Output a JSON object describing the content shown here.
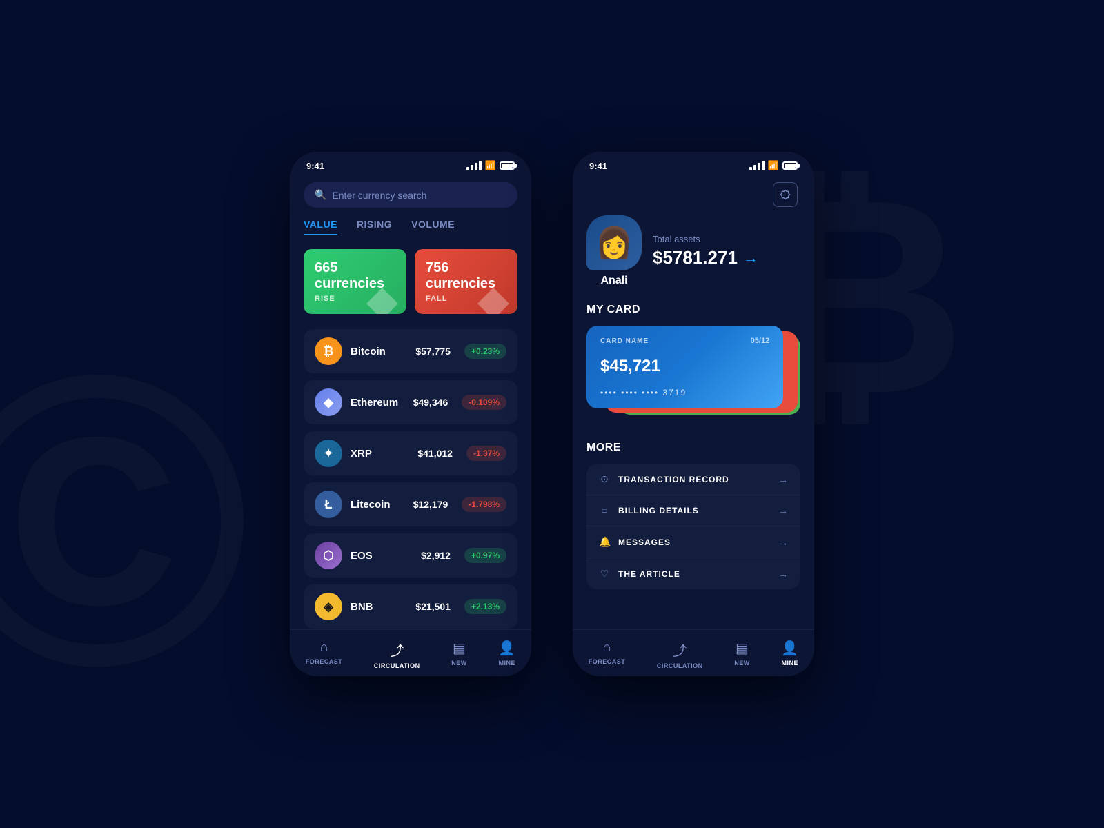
{
  "background": {
    "symbol1": "©",
    "symbol2": "₿"
  },
  "phone1": {
    "statusBar": {
      "time": "9:41"
    },
    "search": {
      "placeholder": "Enter currency search"
    },
    "tabs": [
      {
        "label": "VALUE",
        "active": true
      },
      {
        "label": "RISING",
        "active": false
      },
      {
        "label": "VOLUME",
        "active": false
      }
    ],
    "stats": [
      {
        "number": "665 currencies",
        "label": "RISE",
        "type": "rise"
      },
      {
        "number": "756 currencies",
        "label": "FALL",
        "type": "fall"
      }
    ],
    "cryptos": [
      {
        "name": "Bitcoin",
        "price": "$57,775",
        "change": "+0.23%",
        "positive": true,
        "symbol": "₿",
        "logoClass": "btc-logo"
      },
      {
        "name": "Ethereum",
        "price": "$49,346",
        "change": "-0.109%",
        "positive": false,
        "symbol": "◆",
        "logoClass": "eth-logo"
      },
      {
        "name": "XRP",
        "price": "$41,012",
        "change": "-1.37%",
        "positive": false,
        "symbol": "✦",
        "logoClass": "xrp-logo"
      },
      {
        "name": "Litecoin",
        "price": "$12,179",
        "change": "-1.798%",
        "positive": false,
        "symbol": "Ł",
        "logoClass": "ltc-logo"
      },
      {
        "name": "EOS",
        "price": "$2,912",
        "change": "+0.97%",
        "positive": true,
        "symbol": "⬡",
        "logoClass": "eos-logo"
      },
      {
        "name": "BNB",
        "price": "$21,501",
        "change": "+2.13%",
        "positive": true,
        "symbol": "◈",
        "logoClass": "bnb-logo"
      }
    ],
    "bottomNav": [
      {
        "label": "FORECAST",
        "icon": "⌂",
        "active": false
      },
      {
        "label": "CIRCULATION",
        "icon": "⤴",
        "active": true
      },
      {
        "label": "NEW",
        "icon": "▤",
        "active": false
      },
      {
        "label": "MINE",
        "icon": "👤",
        "active": false
      }
    ]
  },
  "phone2": {
    "statusBar": {
      "time": "9:41"
    },
    "user": {
      "name": "Anali",
      "totalAssetsLabel": "Total assets",
      "totalAssetsValue": "$5781.271"
    },
    "myCard": {
      "sectionTitle": "MY CARD",
      "cardName": "CARD NAME",
      "expiry": "05/12",
      "amount": "$45,721",
      "cardNumber": "•••• •••• •••• 3719"
    },
    "more": {
      "sectionTitle": "MORE",
      "items": [
        {
          "icon": "⊙",
          "label": "TRANSACTION RECORD"
        },
        {
          "icon": "≡",
          "label": "BILLING DETAILS"
        },
        {
          "icon": "🔔",
          "label": "MESSAGES"
        },
        {
          "icon": "♡",
          "label": "THE ARTICLE"
        }
      ]
    },
    "bottomNav": [
      {
        "label": "FORECAST",
        "icon": "⌂",
        "active": false
      },
      {
        "label": "CIRCULATION",
        "icon": "⤴",
        "active": false
      },
      {
        "label": "NEW",
        "icon": "▤",
        "active": false
      },
      {
        "label": "MINE",
        "icon": "👤",
        "active": true
      }
    ]
  }
}
